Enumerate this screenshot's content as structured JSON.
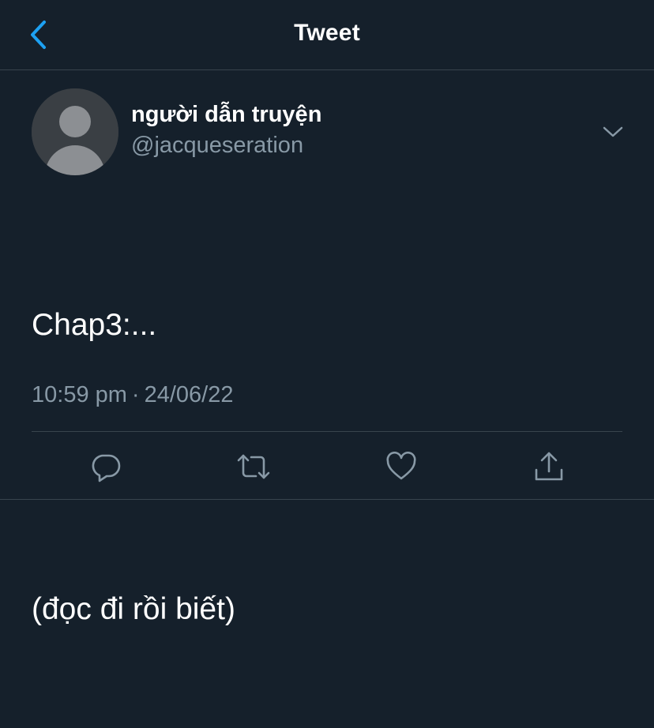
{
  "header": {
    "title": "Tweet",
    "back_icon": "chevron-left-icon"
  },
  "tweet": {
    "author": {
      "display_name": "người dẫn truyện",
      "handle": "@jacqueseration",
      "avatar_icon": "default-avatar-icon"
    },
    "text_lines": [
      "Chap3:...",
      "",
      "(đọc đi rồi biết)"
    ],
    "time": "10:59 pm",
    "separator": "·",
    "date": "24/06/22",
    "more_icon": "chevron-down-icon"
  },
  "actions": [
    {
      "name": "reply",
      "icon": "reply-icon"
    },
    {
      "name": "retweet",
      "icon": "retweet-icon"
    },
    {
      "name": "like",
      "icon": "heart-icon"
    },
    {
      "name": "share",
      "icon": "share-icon"
    }
  ],
  "colors": {
    "background": "#15202b",
    "accent": "#1da1f2",
    "secondary_text": "#8899a6",
    "border": "#38444d",
    "icon": "#8899a6"
  }
}
